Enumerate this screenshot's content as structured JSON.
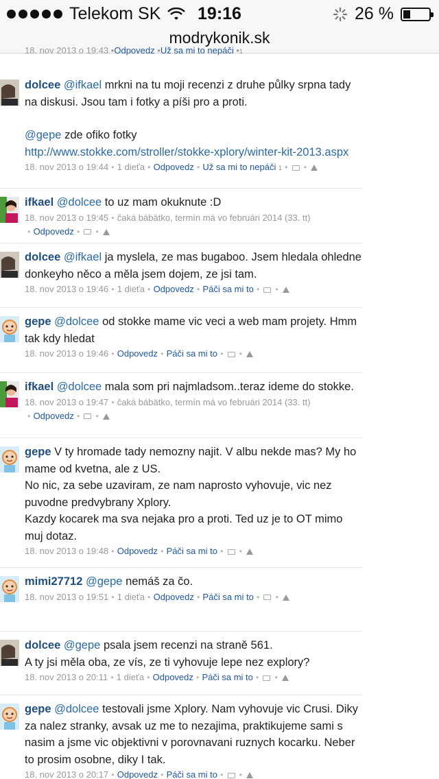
{
  "status": {
    "carrier": "Telekom SK",
    "time": "19:16",
    "battery": "26 %",
    "battery_level": 0.26
  },
  "url": "modrykonik.sk",
  "stub": {
    "date": "18. nov 2013 o 19:43",
    "reply": "Odpovedz",
    "dislike": "Už sa mi to nepáči",
    "count": "1"
  },
  "comments": [
    {
      "author": "dolcee",
      "avatar": "photo-avatar-dark",
      "mention": "@ifkael",
      "paras": [
        "mrkni na tu moji recenzi z druhe půlky srpna tady na diskusi. Jsou tam i fotky a píši pro a proti."
      ],
      "extra_mention": "@gepe",
      "extra_text": "zde ofiko fotky",
      "link": "http://www.stokke.com/stroller/stokke-xplory/winter-kit-2013.aspx",
      "date": "18. nov 2013 o 19:44",
      "kids": "1 dieťa",
      "reply": "Odpovedz",
      "like": "Už sa mi to nepáči",
      "like_count": "1"
    },
    {
      "author": "ifkael",
      "avatar": "photo-avatar-green",
      "mention": "@dolcee",
      "paras": [
        "to uz mam okuknute :D"
      ],
      "date": "18. nov 2013 o 19:45",
      "status": "čaká bábätko, termín má vo februári 2014 (33. tt)",
      "reply": "Odpovedz"
    },
    {
      "author": "dolcee",
      "avatar": "photo-avatar-dark",
      "mention": "@ifkael",
      "paras": [
        "ja myslela, ze mas bugaboo. Jsem hledala ohledne donkeyho něco a měla jsem dojem, ze jsi tam."
      ],
      "date": "18. nov 2013 o 19:46",
      "kids": "1 dieťa",
      "reply": "Odpovedz",
      "like": "Páči sa mi to"
    },
    {
      "author": "gepe",
      "avatar": "cartoon-avatar",
      "mention": "@dolcee",
      "paras": [
        "od stokke mame vic veci a web mam projety. Hmm tak kdy hledat"
      ],
      "date": "18. nov 2013 o 19:46",
      "reply": "Odpovedz",
      "like": "Páči sa mi to"
    },
    {
      "author": "ifkael",
      "avatar": "photo-avatar-green",
      "mention": "@dolcee",
      "paras": [
        "mala som pri najmladsom..teraz ideme do stokke."
      ],
      "date": "18. nov 2013 o 19:47",
      "status": "čaká bábätko, termín má vo februári 2014 (33. tt)",
      "reply": "Odpovedz"
    },
    {
      "author": "gepe",
      "avatar": "cartoon-avatar",
      "mention": "",
      "paras": [
        "V ty hromade tady nemozny najit. V albu nekde mas? My ho mame od kvetna, ale z US.",
        "No nic, za sebe uzaviram, ze nam naprosto vyhovuje, vic nez puvodne predvybrany Xplory.",
        "Kazdy kocarek ma sva nejaka pro a proti. Ted uz je to OT mimo muj dotaz."
      ],
      "date": "18. nov 2013 o 19:48",
      "reply": "Odpovedz",
      "like": "Páči sa mi to"
    },
    {
      "author": "mimi27712",
      "avatar": "cartoon-avatar",
      "mention": "@gepe",
      "paras": [
        "nemáš za čo."
      ],
      "date": "18. nov 2013 o 19:51",
      "kids": "1 dieťa",
      "reply": "Odpovedz",
      "like": "Páči sa mi to"
    },
    {
      "author": "dolcee",
      "avatar": "photo-avatar-dark",
      "mention": "@gepe",
      "paras": [
        "psala jsem recenzi na straně 561.",
        "A ty jsi měla oba, ze vís, ze ti vyhovuje lepe nez explory?"
      ],
      "date": "18. nov 2013 o 20:11",
      "kids": "1 dieťa",
      "reply": "Odpovedz",
      "like": "Páči sa mi to"
    },
    {
      "author": "gepe",
      "avatar": "cartoon-avatar",
      "mention": "@dolcee",
      "paras": [
        "testovali jsme Xplory. Nam vyhovuje vic Crusi. Diky za nalez stranky, avsak uz me to nezajima, praktikujeme sami s nasim a jsme vic objektivni v porovnavani ruznych kocarku. Neber to prosim osobne, diky I tak."
      ],
      "date": "18. nov 2013 o 20:17",
      "reply": "Odpovedz",
      "like": "Páči sa mi to"
    }
  ]
}
